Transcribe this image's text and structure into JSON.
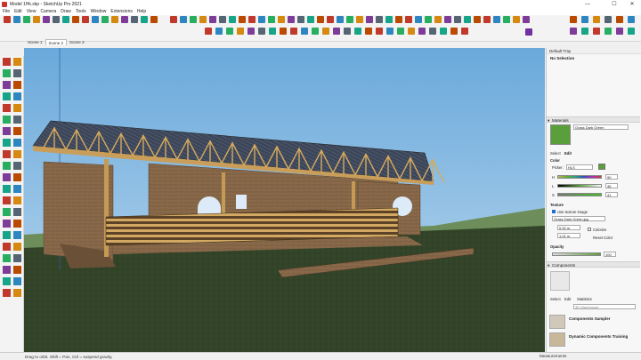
{
  "window": {
    "title": "Model 1Hk.skp - SketchUp Pro 2021"
  },
  "menu": [
    "File",
    "Edit",
    "View",
    "Camera",
    "Draw",
    "Tools",
    "Window",
    "Extensions",
    "Help"
  ],
  "scenes": [
    {
      "label": "Scene 1",
      "active": false
    },
    {
      "label": "Scene 2",
      "active": true
    },
    {
      "label": "Scene 3",
      "active": false
    }
  ],
  "status": {
    "hint": "Drag to orbit. Shift = Pan, Ctrl = suspend gravity.",
    "measurements_label": "Measurements"
  },
  "tray": {
    "title": "Default Tray",
    "selection": "No Selection",
    "materials": {
      "header": "Materials",
      "name": "Grass Dark Green",
      "tabs": [
        "Select",
        "Edit"
      ],
      "color_label": "Color",
      "picker_label": "Picker:",
      "picker_value": "HLS",
      "h_label": "H",
      "h_value": "90",
      "l_label": "L",
      "l_value": "46",
      "s_label": "S",
      "s_value": "41",
      "texture_label": "Texture",
      "use_texture": "Use texture image",
      "texture_file": "Grass Dark Green.jpg",
      "width": "0,92 m",
      "height": "1,01 m",
      "colorize": "Colorize",
      "reset_color": "Reset Color",
      "opacity_label": "Opacity",
      "opacity_value": "100",
      "swatch_color": "#5aa03a"
    },
    "components": {
      "header": "Components",
      "tabs": [
        "Select",
        "Edit",
        "Statistics"
      ],
      "search_placeholder": "3D Warehouse",
      "items": [
        "Components Sampler",
        "Dynamic Components Training"
      ]
    }
  },
  "colors": {
    "sky": "#8ec0e6",
    "grass": "#35482a",
    "accent": "#7030a0"
  }
}
